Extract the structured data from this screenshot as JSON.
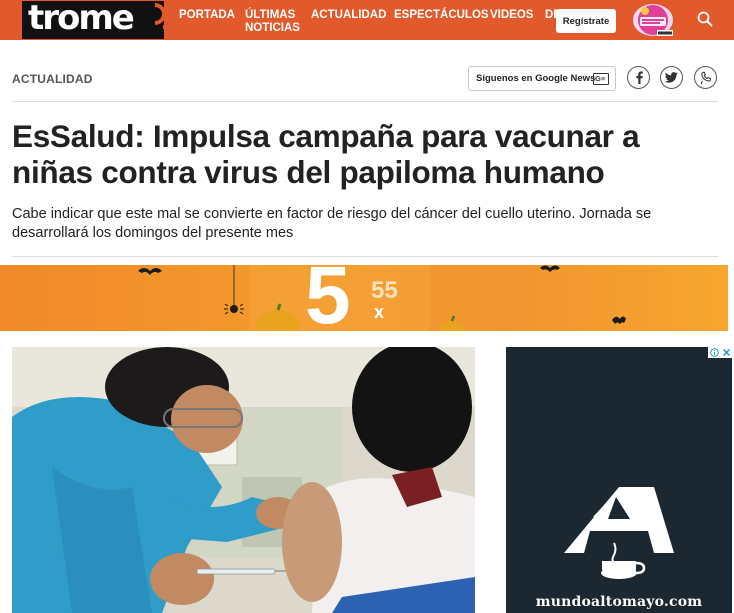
{
  "header": {
    "logo_text": "trome",
    "nav": [
      {
        "label": "PORTADA"
      },
      {
        "label": "ÚLTIMAS\nNOTICIAS"
      },
      {
        "label": "ACTUALIDAD"
      },
      {
        "label": "ESPECTÁCULOS"
      },
      {
        "label": "VIDEOS"
      },
      {
        "label": "DE"
      }
    ],
    "register_label": "Regístrate",
    "search_icon": "search-icon",
    "brand_color": "#e2592b"
  },
  "article": {
    "section": "ACTUALIDAD",
    "google_news_label": "Síguenos en Google News",
    "google_news_icon": "G≡",
    "share_icons": [
      "facebook-icon",
      "twitter-icon",
      "whatsapp-icon"
    ],
    "title": "EsSalud: Impulsa campaña para vacunar a niñas contra virus del papiloma humano",
    "summary": "Cabe indicar que este mal se convierte en factor de riesgo del cáncer del cuello uterino. Jornada se desarrollará los domingos del presente mes",
    "photo_description_icon": "vaccination-photo"
  },
  "banner_ad": {
    "big_digit": "5",
    "small_digit": "55",
    "small_letter": "x"
  },
  "side_ad": {
    "logo_letter": "A",
    "domain": "mundoaltomayo.com",
    "adchoices_icons": [
      "info-icon",
      "close-icon"
    ]
  }
}
